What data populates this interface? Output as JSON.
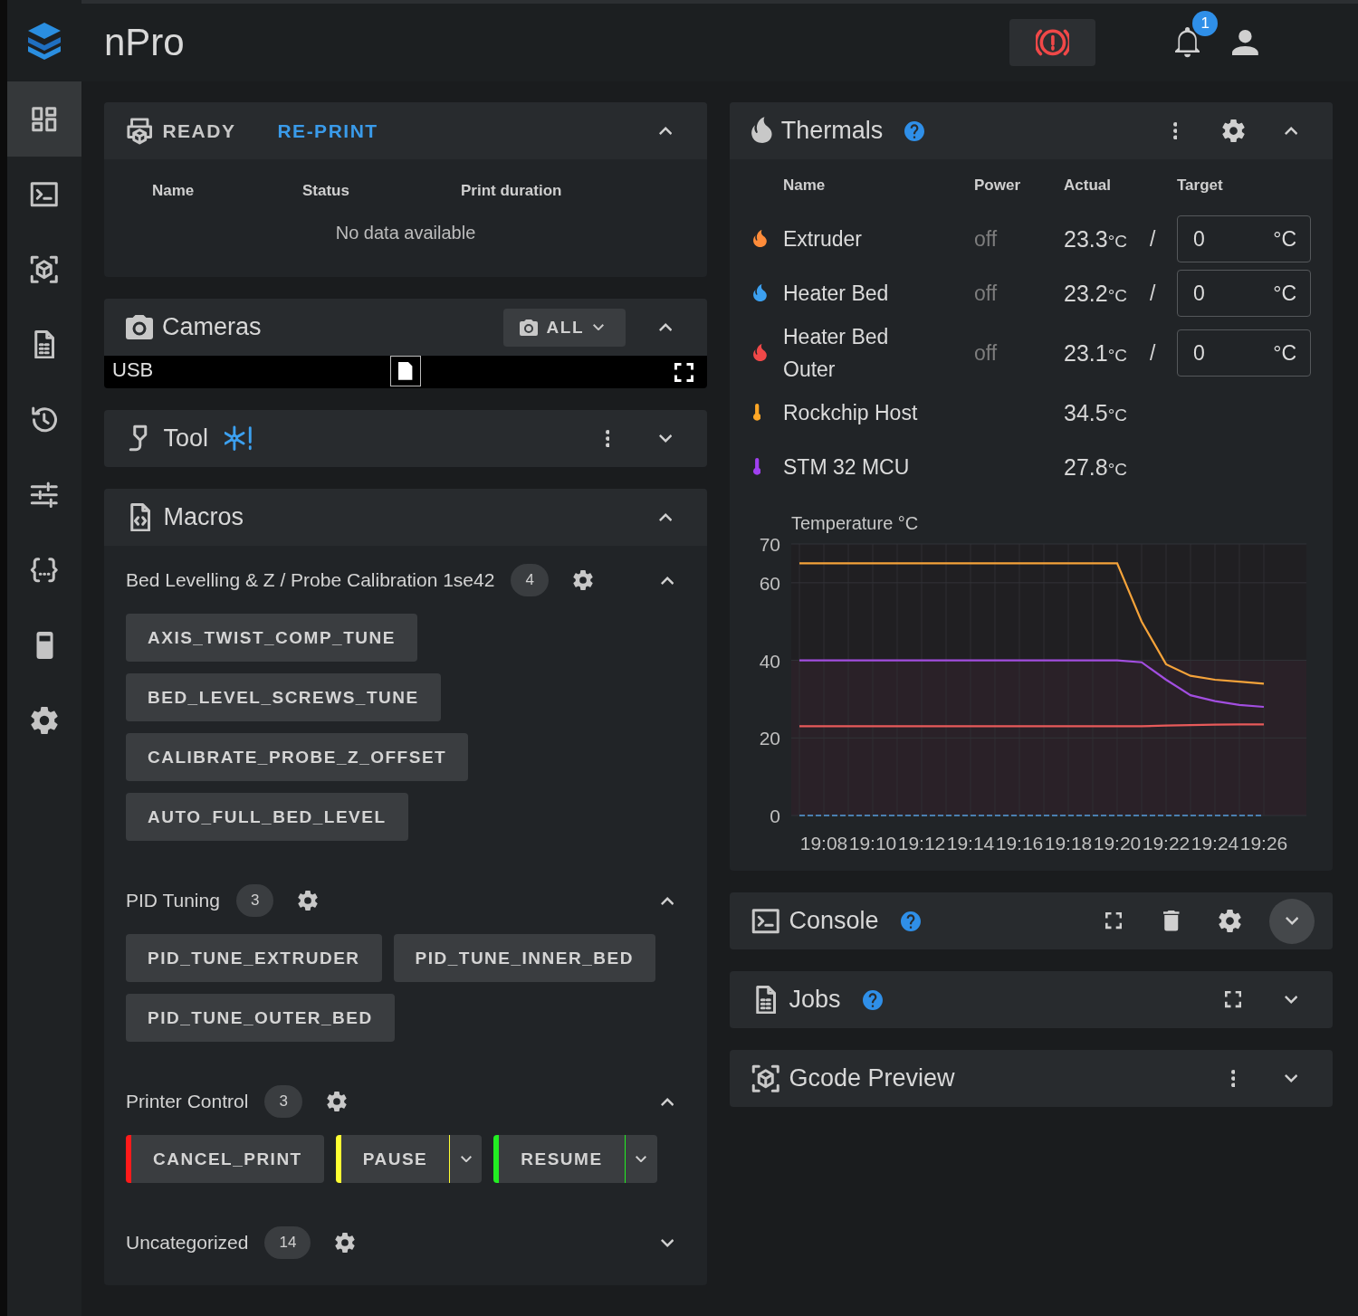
{
  "app": {
    "title": "nPro",
    "notification_count": "1"
  },
  "sidebar": {
    "items": [
      {
        "kind": "dashboard",
        "selected": true
      },
      {
        "kind": "console",
        "selected": false
      },
      {
        "kind": "cube",
        "selected": false
      },
      {
        "kind": "file",
        "selected": false
      },
      {
        "kind": "history",
        "selected": false
      },
      {
        "kind": "tune",
        "selected": false
      },
      {
        "kind": "braces",
        "selected": false
      },
      {
        "kind": "device",
        "selected": false
      },
      {
        "kind": "gear",
        "selected": false
      }
    ]
  },
  "status_panel": {
    "state": "READY",
    "action": "RE-PRINT",
    "expanded": true,
    "columns": [
      "Name",
      "Status",
      "Print duration"
    ],
    "empty_text": "No data available"
  },
  "cameras": {
    "title": "Cameras",
    "filter": "ALL",
    "expanded": true,
    "feed_label": "USB"
  },
  "tool": {
    "title": "Tool",
    "expanded": false
  },
  "macros": {
    "title": "Macros",
    "expanded": true,
    "groups": [
      {
        "name": "Bed Levelling & Z / Probe Calibration 1se42",
        "count": "4",
        "expanded": true,
        "macros": [
          {
            "label": "AXIS_TWIST_COMP_TUNE"
          },
          {
            "label": "BED_LEVEL_SCREWS_TUNE"
          },
          {
            "label": "CALIBRATE_PROBE_Z_OFFSET"
          },
          {
            "label": "AUTO_FULL_BED_LEVEL"
          }
        ]
      },
      {
        "name": "PID Tuning",
        "count": "3",
        "expanded": true,
        "macros": [
          {
            "label": "PID_TUNE_EXTRUDER"
          },
          {
            "label": "PID_TUNE_INNER_BED"
          },
          {
            "label": "PID_TUNE_OUTER_BED"
          }
        ]
      },
      {
        "name": "Printer Control",
        "count": "3",
        "expanded": true,
        "macros": [
          {
            "label": "CANCEL_PRINT",
            "color": "#ff1a1a",
            "has_menu": false
          },
          {
            "label": "PAUSE",
            "color": "#ffff33",
            "has_menu": true
          },
          {
            "label": "RESUME",
            "color": "#22ee22",
            "has_menu": true
          }
        ]
      },
      {
        "name": "Uncategorized",
        "count": "14",
        "expanded": false
      }
    ]
  },
  "thermals": {
    "title": "Thermals",
    "expanded": true,
    "columns": [
      "Name",
      "Power",
      "Actual",
      "Target"
    ],
    "rows": [
      {
        "kind": "heater",
        "name": "Extruder",
        "color": "#ff8c3a",
        "power": "off",
        "actual": "23.3",
        "unit": "°C",
        "separator": "/",
        "target": "0",
        "target_unit": "°C"
      },
      {
        "kind": "heater",
        "name": "Heater Bed",
        "color": "#3ca0f0",
        "power": "off",
        "actual": "23.2",
        "unit": "°C",
        "separator": "/",
        "target": "0",
        "target_unit": "°C"
      },
      {
        "kind": "heater",
        "name": "Heater Bed Outer",
        "color": "#f04848",
        "power": "off",
        "actual": "23.1",
        "unit": "°C",
        "separator": "/",
        "target": "0",
        "target_unit": "°C"
      },
      {
        "kind": "sensor",
        "name": "Rockchip Host",
        "color": "#ffa726",
        "actual": "34.5",
        "unit": "°C"
      },
      {
        "kind": "sensor",
        "name": "STM 32 MCU",
        "color": "#a040f0",
        "actual": "27.8",
        "unit": "°C"
      }
    ],
    "chart_data": {
      "type": "line",
      "ylabel": "Temperature °C",
      "categories": [
        null,
        "19:08",
        null,
        "19:10",
        null,
        "19:12",
        null,
        "19:14",
        null,
        "19:16",
        null,
        "19:18",
        null,
        "19:20",
        null,
        "19:22",
        null,
        "19:24",
        null,
        "19:26"
      ],
      "ylim": [
        0,
        70
      ],
      "yticks": [
        0,
        20,
        40,
        60,
        70
      ],
      "grid": true,
      "series": [
        {
          "color": "#f5a33a",
          "line_style": "solid",
          "values": [
            65,
            65,
            65,
            65,
            65,
            65,
            65,
            65,
            65,
            65,
            65,
            65,
            65,
            65,
            50,
            39,
            36,
            35,
            34.5,
            34
          ]
        },
        {
          "color": "#a24ee0",
          "line_style": "solid",
          "values": [
            40,
            40,
            40,
            40,
            40,
            40,
            40,
            40,
            40,
            40,
            40,
            40,
            40,
            40,
            39.5,
            35,
            31,
            29.5,
            28.5,
            28
          ]
        },
        {
          "color": "#e85a5a",
          "line_style": "solid",
          "values": [
            23,
            23,
            23,
            23,
            23,
            23,
            23,
            23,
            23,
            23,
            23,
            23,
            23,
            23,
            23,
            23.2,
            23.3,
            23.4,
            23.5,
            23.5
          ]
        },
        {
          "color": "#4a7fb0",
          "line_style": "dashed",
          "values": [
            0,
            0,
            0,
            0,
            0,
            0,
            0,
            0,
            0,
            0,
            0,
            0,
            0,
            0,
            0,
            0,
            0,
            0,
            0,
            0
          ]
        }
      ]
    }
  },
  "console": {
    "title": "Console",
    "expanded": false,
    "highlighted": true
  },
  "jobs": {
    "title": "Jobs",
    "expanded": false
  },
  "gcode_preview": {
    "title": "Gcode Preview",
    "expanded": false
  }
}
